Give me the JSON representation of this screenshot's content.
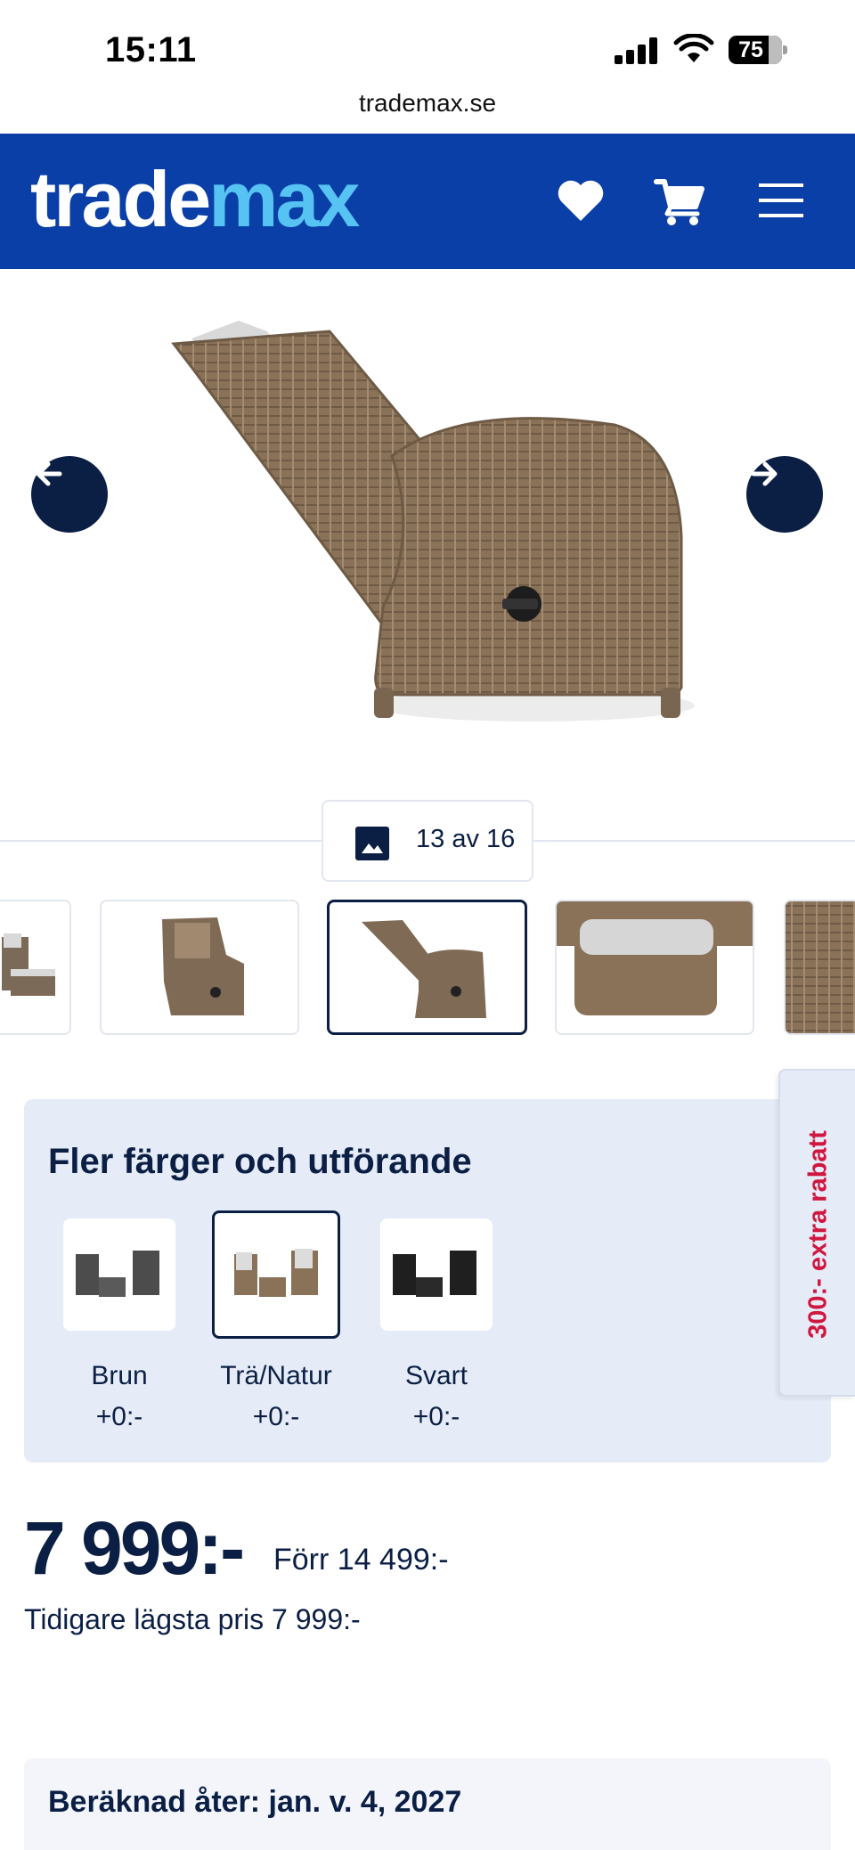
{
  "status_bar": {
    "time": "15:11",
    "battery": "75"
  },
  "browser": {
    "url": "trademax.se"
  },
  "header": {
    "logo_part1": "trade",
    "logo_part2": "max"
  },
  "gallery": {
    "counter": "13 av 16"
  },
  "variants": {
    "title": "Fler färger och utförande",
    "items": [
      {
        "name": "Brun",
        "price": "+0:-"
      },
      {
        "name": "Trä/Natur",
        "price": "+0:-"
      },
      {
        "name": "Svart",
        "price": "+0:-"
      }
    ]
  },
  "side_tab": {
    "label": "300:- extra rabatt"
  },
  "pricing": {
    "price": "7 999:-",
    "was": "Förr 14 499:-",
    "lowest": "Tidigare lägsta pris 7 999:-"
  },
  "delivery": {
    "text": "Beräknad åter: jan. v. 4, 2027"
  },
  "colors": {
    "brand_blue": "#0a3fa7",
    "logo_accent": "#56c3f2",
    "navy": "#0b1f45",
    "promo_red": "#d0173f",
    "panel_bg": "#e6ecf7"
  }
}
